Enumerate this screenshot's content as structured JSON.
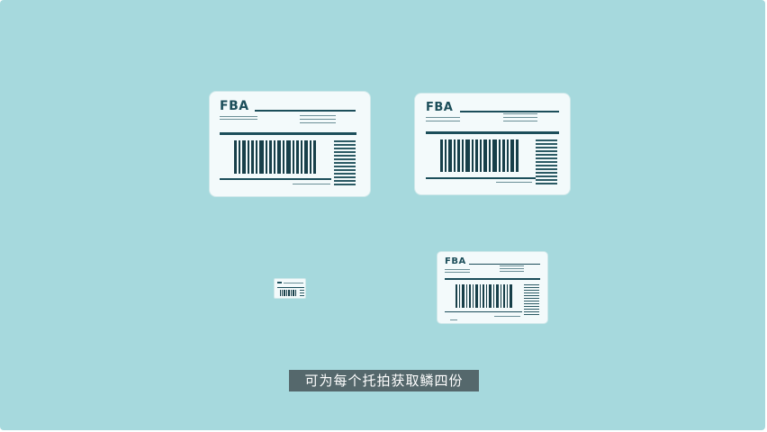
{
  "labels": [
    {
      "title": "FBA"
    },
    {
      "title": "FBA"
    },
    {
      "title": "FBA"
    }
  ],
  "caption": "可为每个托拍获取鳞四份"
}
